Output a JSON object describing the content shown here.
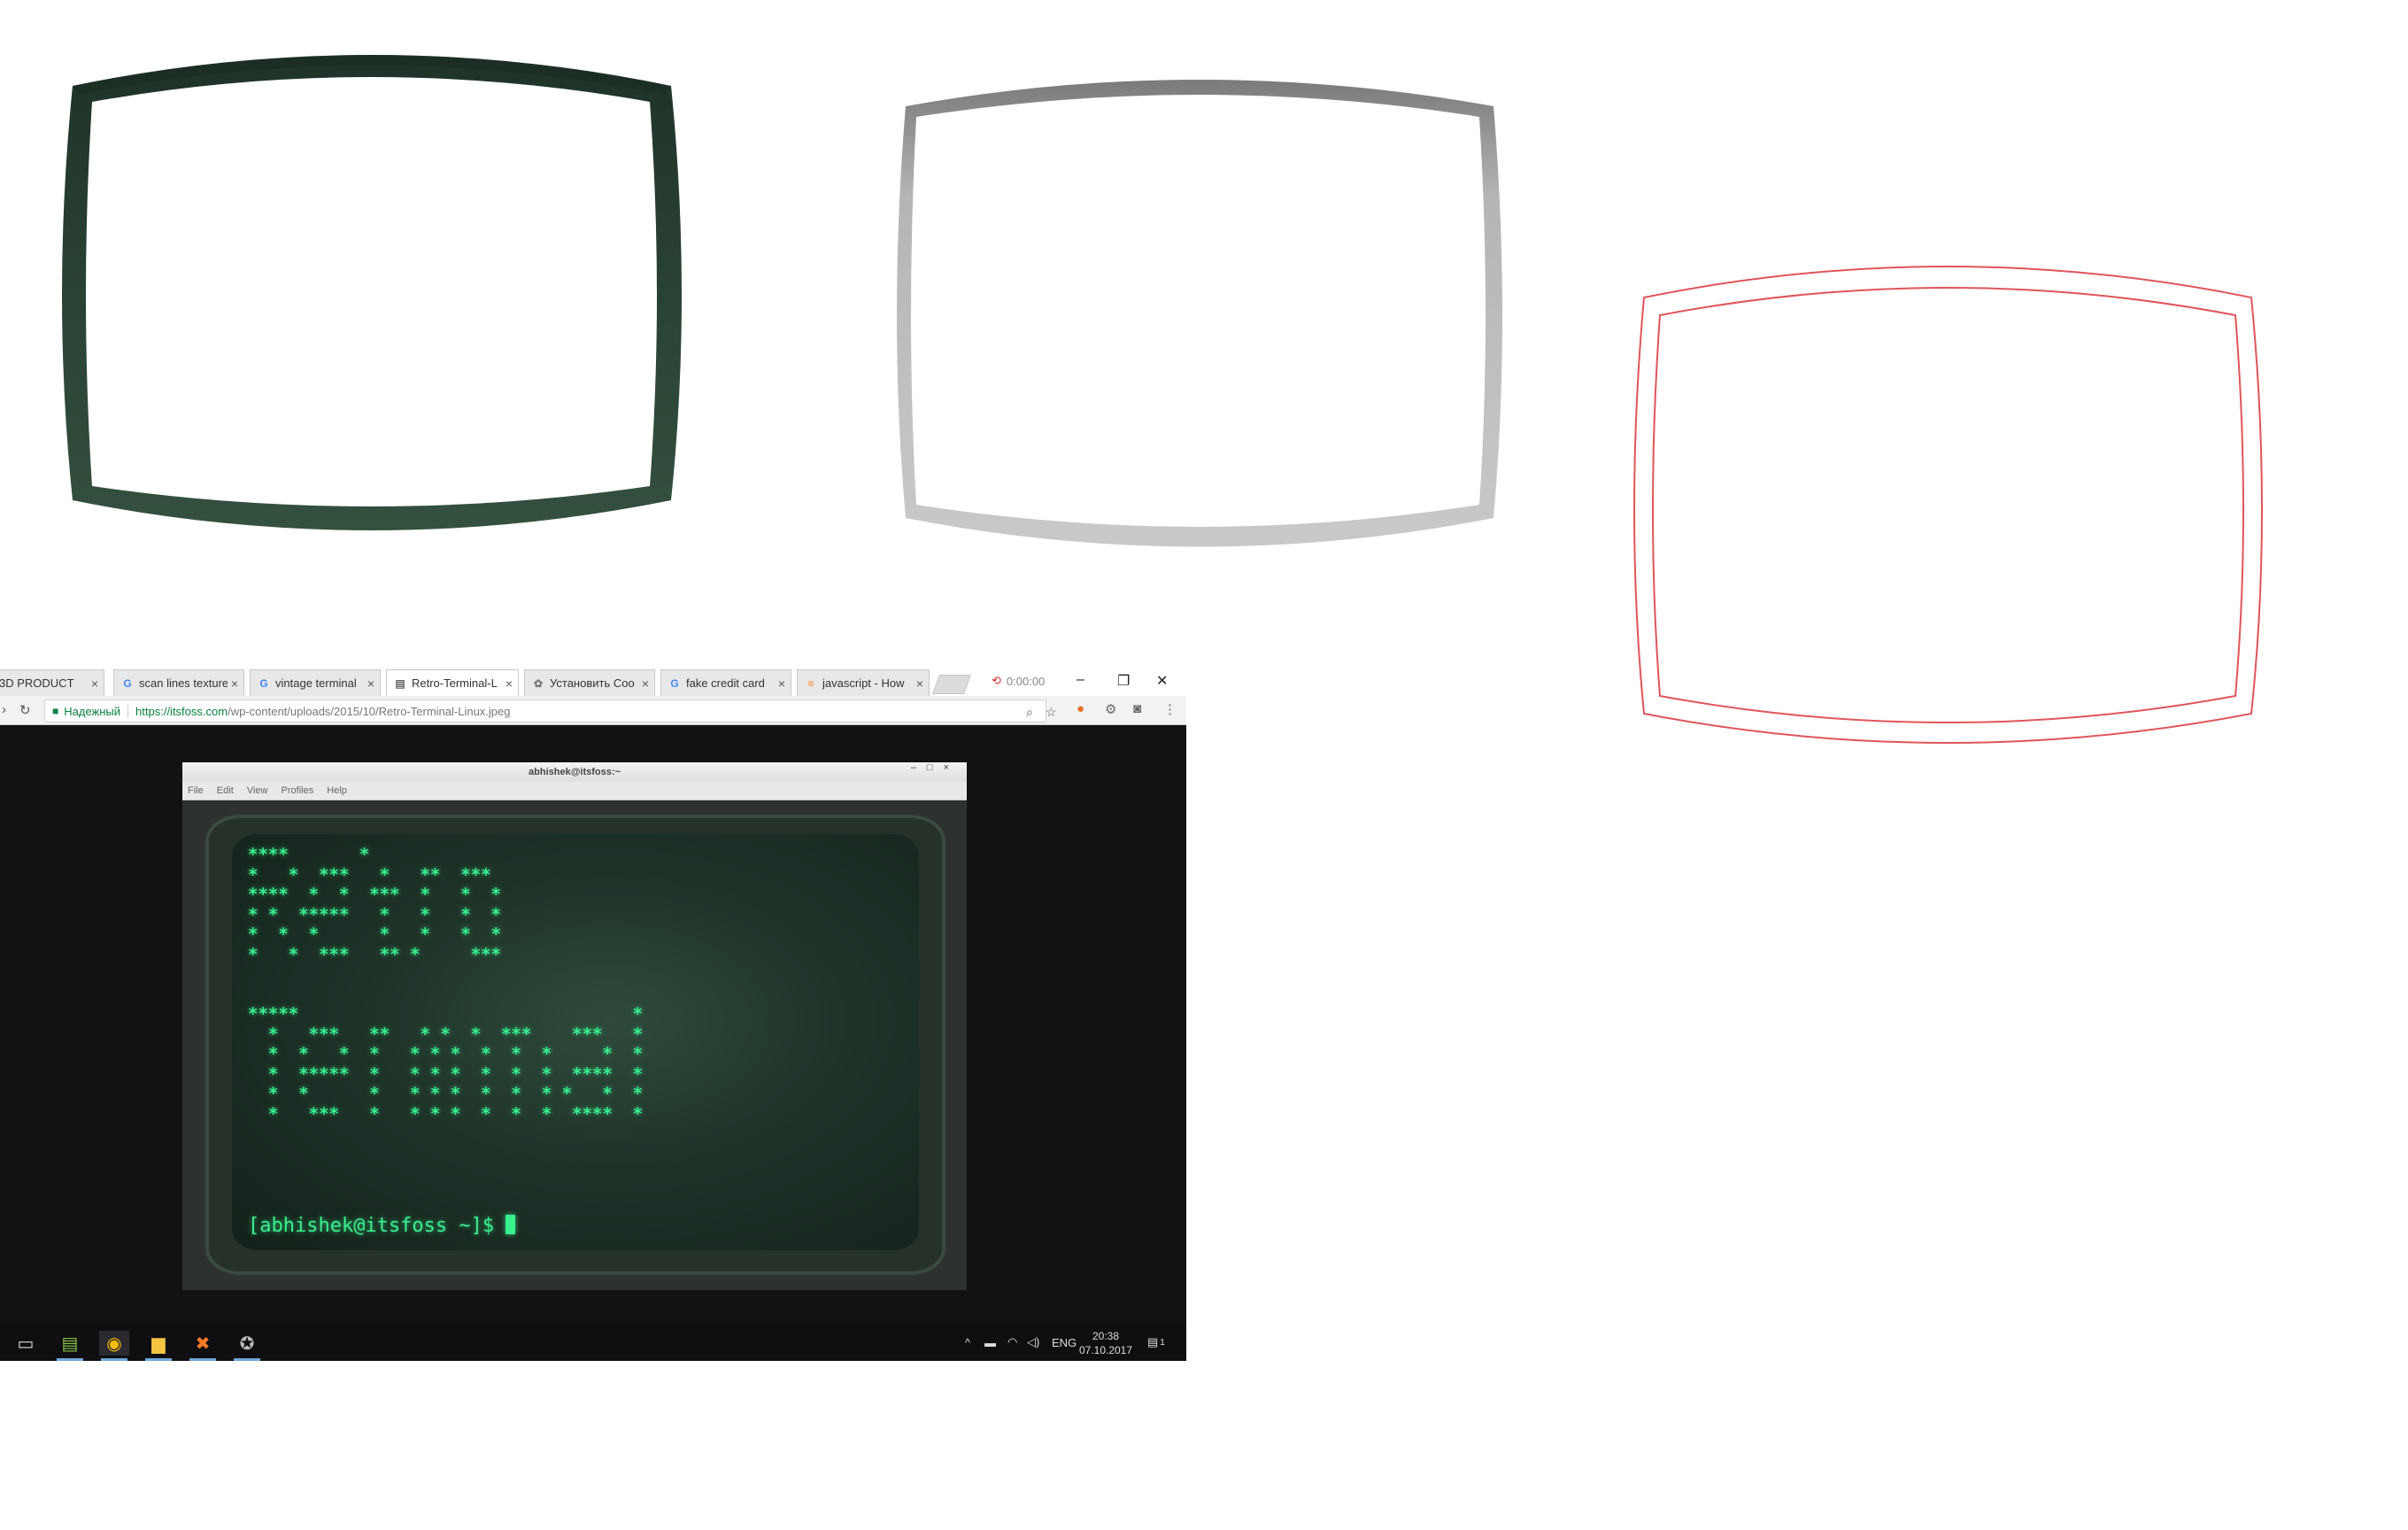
{
  "browser": {
    "tabs": [
      {
        "label": "3D PRODUCT",
        "icon": "doc-icon",
        "active": false
      },
      {
        "label": "scan lines texture",
        "icon": "google-icon",
        "active": false
      },
      {
        "label": "vintage terminal",
        "icon": "google-icon",
        "active": false
      },
      {
        "label": "Retro-Terminal-L",
        "icon": "image-icon",
        "active": true
      },
      {
        "label": "Установить Coo",
        "icon": "puzzle-icon",
        "active": false
      },
      {
        "label": "fake credit card",
        "icon": "google-icon",
        "active": false
      },
      {
        "label": "javascript - How",
        "icon": "stackoverflow-icon",
        "active": false
      }
    ],
    "extension_value": "0:00:00",
    "secure_label": "Надежный",
    "url_host": "https://itsfoss.com",
    "url_path": "/wp-content/uploads/2015/10/Retro-Terminal-Linux.jpeg"
  },
  "terminal": {
    "title": "abhishek@itsfoss:~",
    "menu": [
      "File",
      "Edit",
      "View",
      "Profiles",
      "Help"
    ],
    "ascii_art": "****       *\n*   *  ***   *   **  ***\n****  *  *  ***  *   *  *\n* *  *****   *   *   *  *\n*  *  *      *   *   *  *\n*   *  ***   ** *     ***\n\n\n*****                                 *\n  *   ***   **   * *  *  ***    ***   *\n  *  *   *  *   * * *  *  *  *     *  *\n  *  *****  *   * * *  *  *  *  ****  *\n  *  *      *   * * *  *  *  * *   *  *\n  *   ***   *   * * *  *  *  *  ****  *",
    "prompt": "[abhishek@itsfoss ~]$ "
  },
  "taskbar": {
    "apps": [
      "task-view-icon",
      "notepad-icon",
      "chrome-icon",
      "explorer-icon",
      "xampp-icon",
      "app-icon"
    ],
    "language": "ENG",
    "time": "20:38",
    "date": "07.10.2017",
    "notification_count": "1"
  },
  "colors": {
    "frame_dark": "#2b3f34",
    "frame_gray": "#b8b8b8",
    "frame_red": "#e0555b",
    "phosphor": "#39f08f"
  }
}
